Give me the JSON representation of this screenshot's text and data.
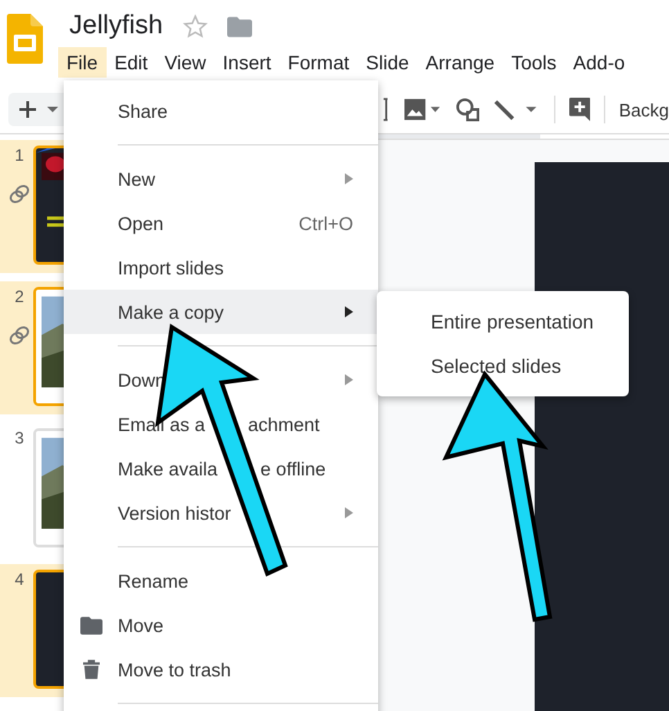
{
  "document": {
    "title": "Jellyfish"
  },
  "menubar": [
    {
      "label": "File",
      "selected": true
    },
    {
      "label": "Edit",
      "selected": false
    },
    {
      "label": "View",
      "selected": false
    },
    {
      "label": "Insert",
      "selected": false
    },
    {
      "label": "Format",
      "selected": false
    },
    {
      "label": "Slide",
      "selected": false
    },
    {
      "label": "Arrange",
      "selected": false
    },
    {
      "label": "Tools",
      "selected": false
    },
    {
      "label": "Add-o",
      "selected": false
    }
  ],
  "toolbar": {
    "background_button": "Backg"
  },
  "slides": [
    {
      "number": "1",
      "selected": true,
      "linked": true,
      "kind": "dark"
    },
    {
      "number": "2",
      "selected": true,
      "linked": true
    },
    {
      "number": "3",
      "selected": false,
      "linked": false
    },
    {
      "number": "4",
      "selected": true,
      "linked": false,
      "kind": "blank"
    }
  ],
  "file_menu": [
    {
      "kind": "item",
      "label_parts": [
        "Share"
      ],
      "submenu": false,
      "selected": false
    },
    {
      "kind": "divider"
    },
    {
      "kind": "item",
      "label_parts": [
        "New"
      ],
      "submenu": true,
      "selected": false
    },
    {
      "kind": "item",
      "label_parts": [
        "Open"
      ],
      "shortcut": "Ctrl+O",
      "submenu": false,
      "selected": false
    },
    {
      "kind": "item",
      "label_parts": [
        "Import slides"
      ],
      "submenu": false,
      "selected": false
    },
    {
      "kind": "item",
      "label_parts": [
        "Make a copy"
      ],
      "submenu": true,
      "selected": true
    },
    {
      "kind": "divider"
    },
    {
      "kind": "item",
      "label_parts": [
        "Down"
      ],
      "submenu": true,
      "selected": false
    },
    {
      "kind": "item",
      "label_parts": [
        "Email as a",
        "achment"
      ],
      "submenu": false,
      "selected": false
    },
    {
      "kind": "item",
      "label_parts": [
        "Make availa",
        "e offline"
      ],
      "submenu": false,
      "selected": false
    },
    {
      "kind": "item",
      "label_parts": [
        "Version histor"
      ],
      "submenu": true,
      "selected": false
    },
    {
      "kind": "divider"
    },
    {
      "kind": "item",
      "label_parts": [
        "Rename"
      ],
      "submenu": false,
      "selected": false
    },
    {
      "kind": "folder",
      "label_parts": [
        "Move"
      ],
      "submenu": false,
      "selected": false
    },
    {
      "kind": "trash",
      "label_parts": [
        "Move to trash"
      ],
      "submenu": false,
      "selected": false
    },
    {
      "kind": "divider"
    }
  ],
  "copy_submenu": [
    {
      "label": "Entire presentation"
    },
    {
      "label": "Selected slides"
    }
  ]
}
